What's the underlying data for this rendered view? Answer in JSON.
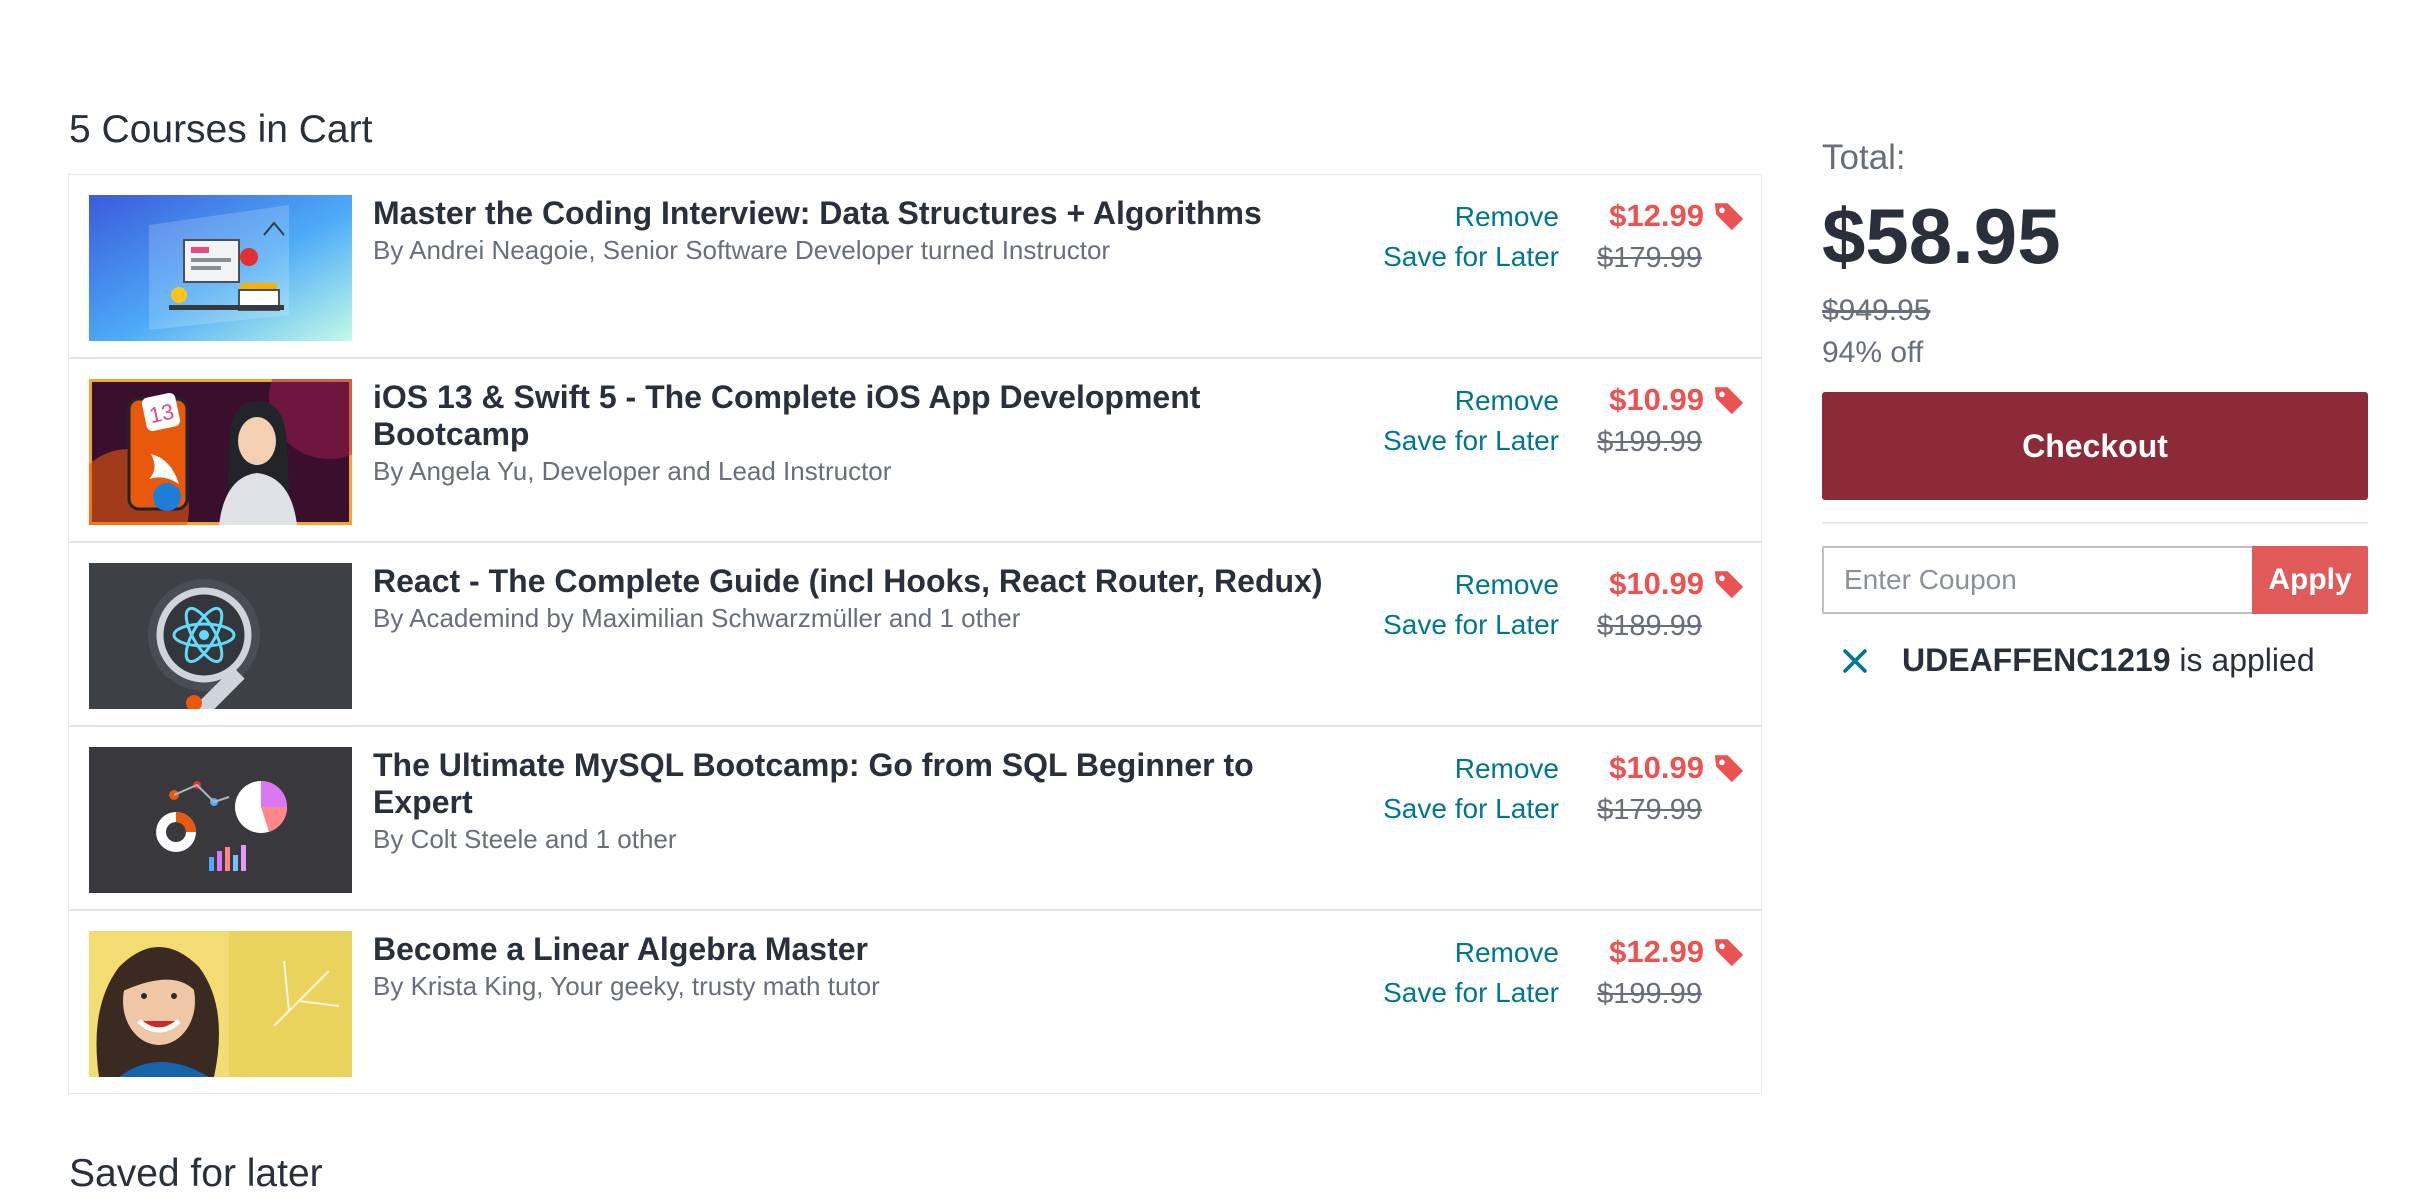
{
  "cart": {
    "heading": "5 Courses in Cart",
    "items": [
      {
        "title": "Master the Coding Interview: Data Structures + Algorithms",
        "author": "By Andrei Neagoie, Senior Software Developer turned Instructor",
        "remove": "Remove",
        "save_later": "Save for Later",
        "price": "$12.99",
        "original_price": "$179.99"
      },
      {
        "title": "iOS 13 & Swift 5 - The Complete iOS App Development Bootcamp",
        "author": "By Angela Yu, Developer and Lead Instructor",
        "remove": "Remove",
        "save_later": "Save for Later",
        "price": "$10.99",
        "original_price": "$199.99"
      },
      {
        "title": "React - The Complete Guide (incl Hooks, React Router, Redux)",
        "author": "By Academind by Maximilian Schwarzmüller and 1 other",
        "remove": "Remove",
        "save_later": "Save for Later",
        "price": "$10.99",
        "original_price": "$189.99"
      },
      {
        "title": "The Ultimate MySQL Bootcamp: Go from SQL Beginner to Expert",
        "author": "By Colt Steele and 1 other",
        "remove": "Remove",
        "save_later": "Save for Later",
        "price": "$10.99",
        "original_price": "$179.99"
      },
      {
        "title": "Become a Linear Algebra Master",
        "author": "By Krista King, Your geeky, trusty math tutor",
        "remove": "Remove",
        "save_later": "Save for Later",
        "price": "$12.99",
        "original_price": "$199.99"
      }
    ]
  },
  "saved": {
    "heading": "Saved for later"
  },
  "summary": {
    "total_label": "Total:",
    "total": "$58.95",
    "original_total": "$949.95",
    "discount": "94% off",
    "checkout_label": "Checkout",
    "coupon_placeholder": "Enter Coupon",
    "apply_label": "Apply",
    "coupon_code": "UDEAFFENC1219",
    "coupon_status": " is applied"
  },
  "icons": {
    "price_tag": "price-tag-icon",
    "remove_coupon": "close-icon"
  },
  "colors": {
    "accent_red": "#ec5252",
    "checkout": "#8c2a38",
    "apply": "#e05a5a",
    "link": "#007791"
  }
}
